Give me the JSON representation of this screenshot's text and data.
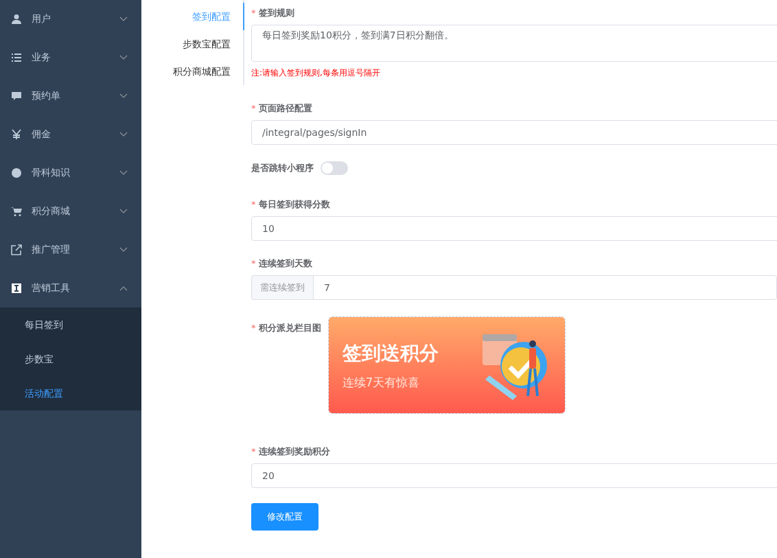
{
  "sidebar": {
    "menu": [
      {
        "label": "用户",
        "expanded": false
      },
      {
        "label": "业务",
        "expanded": false
      },
      {
        "label": "预约单",
        "expanded": false
      },
      {
        "label": "佣金",
        "expanded": false
      },
      {
        "label": "骨科知识",
        "expanded": false
      },
      {
        "label": "积分商城",
        "expanded": false
      },
      {
        "label": "推广管理",
        "expanded": false
      },
      {
        "label": "营销工具",
        "expanded": true,
        "children": [
          {
            "label": "每日签到",
            "selected": false
          },
          {
            "label": "步数宝",
            "selected": false
          },
          {
            "label": "活动配置",
            "selected": true
          }
        ]
      }
    ]
  },
  "tabs": [
    {
      "label": "签到配置",
      "selected": true
    },
    {
      "label": "步数宝配置",
      "selected": false
    },
    {
      "label": "积分商城配置",
      "selected": false
    }
  ],
  "form": {
    "fields": [
      {
        "kind": "textarea",
        "label": "签到规则",
        "mark": "*",
        "value": "每日签到奖励10积分，签到满7日积分翻倍。",
        "hint": "注:请输入签到规则,每条用逗号隔开"
      },
      {
        "kind": "input",
        "label": "页面路径配置",
        "mark": "*",
        "value": "/integral/pages/signIn"
      },
      {
        "kind": "switch",
        "label": "是否跳转小程序",
        "on": false
      },
      {
        "kind": "input",
        "label": "每日签到获得分数",
        "mark": "*",
        "value": "10"
      },
      {
        "kind": "prepend",
        "label": "连续签到天数",
        "mark": "*",
        "prepend": "需连续签到",
        "value": "7"
      },
      {
        "kind": "image",
        "label": "积分派兑栏目图",
        "mark": "*",
        "banner_title": "签到送积分",
        "banner_subtitle": "连续7天有惊喜"
      },
      {
        "kind": "input",
        "label": "连续签到奖励积分",
        "mark": "*",
        "value": "20"
      }
    ],
    "submit": "修改配置"
  }
}
